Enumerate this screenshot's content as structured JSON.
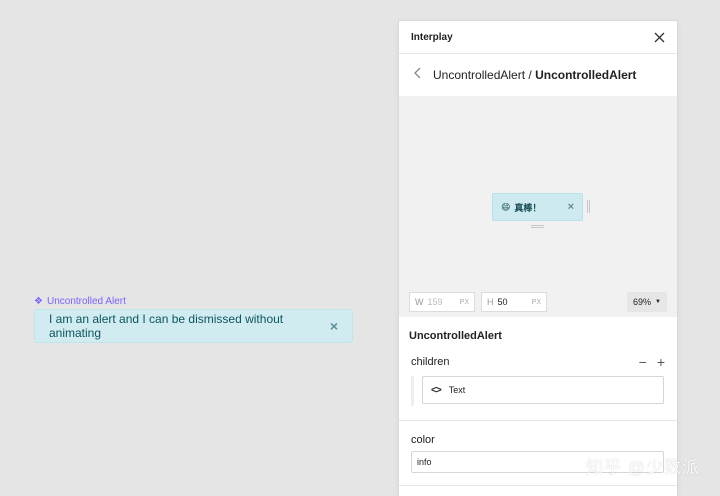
{
  "canvas": {
    "component_label": "Uncontrolled Alert",
    "alert_text": "I am an alert and I can be dismissed without animating",
    "dismiss_glyph": "×"
  },
  "panel": {
    "title": "Interplay",
    "breadcrumb_parent": "UncontrolledAlert",
    "breadcrumb_separator": "/",
    "breadcrumb_current": "UncontrolledAlert",
    "preview": {
      "emoji": "😄",
      "alert_text": "真棒！",
      "dismiss_glyph": "×"
    },
    "size": {
      "w_label": "W",
      "w_value": "159",
      "w_unit": "PX",
      "h_label": "H",
      "h_value": "50",
      "h_unit": "PX"
    },
    "zoom": "69%",
    "component_name": "UncontrolledAlert",
    "props": {
      "children_label": "children",
      "remove_glyph": "−",
      "add_glyph": "+",
      "child_item_label": "Text",
      "color_label": "color",
      "color_value": "info"
    }
  },
  "watermark": "知乎 @少数派",
  "colors": {
    "accent": "#7b61ff",
    "alert_bg": "#d1ecf1",
    "alert_text": "#0c5460"
  },
  "icons": [
    "component-icon",
    "close-icon",
    "back-chevron-icon",
    "dropdown-caret-icon",
    "code-icon"
  ]
}
